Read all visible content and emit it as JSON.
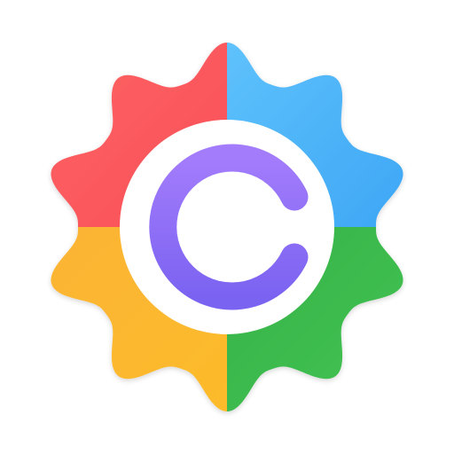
{
  "app_icon": {
    "icon_name": "gear-icon",
    "center_mark": "letter-e-wrench-icon",
    "colors": {
      "top_left": "#F24F57",
      "top_right": "#4EBBF7",
      "bottom_left": "#FDB526",
      "bottom_right": "#34B347",
      "center_disc": "#FFFFFF",
      "mark_gradient_start": "#A37CFC",
      "mark_gradient_end": "#7B63F1"
    }
  }
}
